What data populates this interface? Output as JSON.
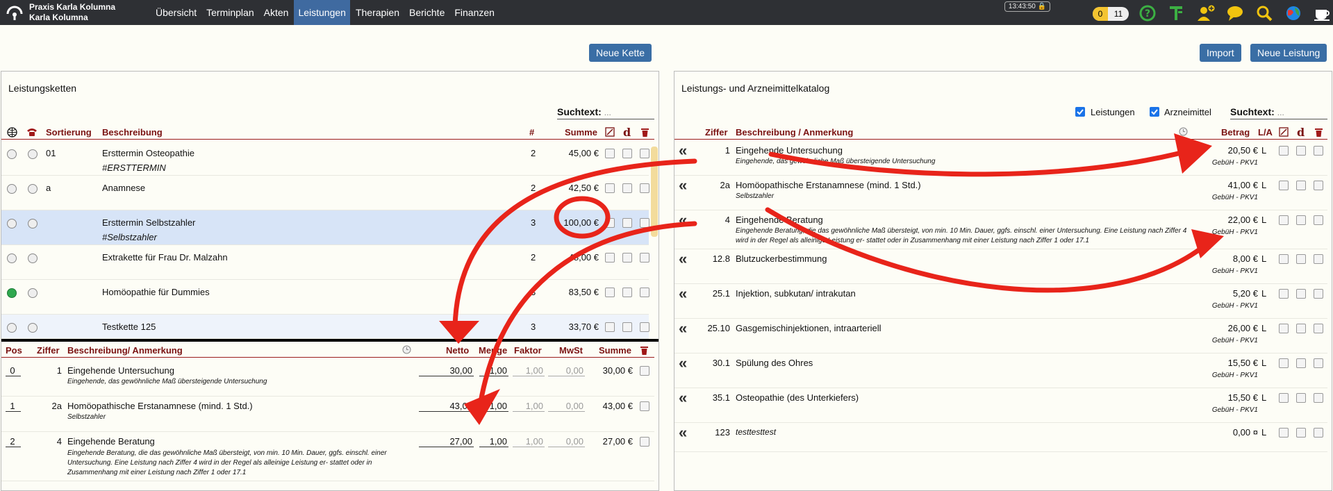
{
  "topbar": {
    "practice_name": "Praxis Karla Kolumna",
    "user_name": "Karla Kolumna",
    "nav": [
      "Übersicht",
      "Terminplan",
      "Akten",
      "Leistungen",
      "Therapien",
      "Berichte",
      "Finanzen"
    ],
    "active_nav": "Leistungen",
    "clock": "13:43:50",
    "counter_a": "0",
    "counter_b": "11",
    "icons": [
      "help-icon",
      "tools-icon",
      "add-user-icon",
      "chat-icon",
      "search-icon",
      "globe-icon",
      "coffee-icon"
    ]
  },
  "buttons": {
    "new_chain": "Neue Kette",
    "import": "Import",
    "new_service": "Neue Leistung"
  },
  "left": {
    "title": "Leistungsketten",
    "search_label": "Suchtext:",
    "search_placeholder": "...",
    "headers": {
      "sort": "Sortierung",
      "desc": "Beschreibung",
      "count": "#",
      "sum": "Summe"
    },
    "chains": [
      {
        "sort": "01",
        "desc": "Ersttermin Osteopathie",
        "tag": "#ERSTTERMIN",
        "count": "2",
        "sum": "45,00 €",
        "active": false,
        "selected": false
      },
      {
        "sort": "a",
        "desc": "Anamnese",
        "tag": "",
        "count": "2",
        "sum": "42,50 €",
        "active": false,
        "selected": false
      },
      {
        "sort": "",
        "desc": "Ersttermin Selbstzahler",
        "tag": "#Selbstzahler",
        "count": "3",
        "sum": "100,00 €",
        "active": false,
        "selected": true
      },
      {
        "sort": "",
        "desc": "Extrakette für Frau Dr. Malzahn",
        "tag": "",
        "count": "2",
        "sum": "48,00 €",
        "active": false,
        "selected": false
      },
      {
        "sort": "",
        "desc": "Homöopathie für Dummies",
        "tag": "",
        "count": "3",
        "sum": "83,50 €",
        "active": true,
        "selected": false
      },
      {
        "sort": "",
        "desc": "Testkette 125",
        "tag": "",
        "count": "3",
        "sum": "33,70 €",
        "active": false,
        "selected": false
      }
    ],
    "items_headers": {
      "pos": "Pos",
      "code": "Ziffer",
      "desc": "Beschreibung/ Anmerkung",
      "net": "Netto",
      "qty": "Menge",
      "factor": "Faktor",
      "vat": "MwSt",
      "sum": "Summe"
    },
    "items": [
      {
        "pos": "0",
        "code": "1",
        "desc": "Eingehende Untersuchung",
        "note": "Eingehende, das gewöhnliche Maß übersteigende Untersuchung",
        "net": "30,00",
        "qty": "1,00",
        "factor": "1,00",
        "vat": "0,00",
        "sum": "30,00 €"
      },
      {
        "pos": "1",
        "code": "2a",
        "desc": "Homöopathische Erstanamnese (mind. 1 Std.)",
        "note": "Selbstzahler",
        "net": "43,00",
        "qty": "1,00",
        "factor": "1,00",
        "vat": "0,00",
        "sum": "43,00 €"
      },
      {
        "pos": "2",
        "code": "4",
        "desc": "Eingehende Beratung",
        "note": "Eingehende Beratung, die das gewöhnliche Maß übersteigt, von min. 10 Min. Dauer, ggfs. einschl. einer Untersuchung. Eine Leistung nach Ziffer 4 wird in der Regel als alleinige Leistung er- stattet oder in Zusammenhang mit einer Leistung nach Ziffer 1 oder 17.1",
        "net": "27,00",
        "qty": "1,00",
        "factor": "1,00",
        "vat": "0,00",
        "sum": "27,00 €"
      }
    ]
  },
  "right": {
    "title": "Leistungs- und Arzneimittelkatalog",
    "filter_services": "Leistungen",
    "filter_drugs": "Arzneimittel",
    "search_label": "Suchtext:",
    "search_placeholder": "...",
    "headers": {
      "code": "Ziffer",
      "desc": "Beschreibung / Anmerkung",
      "amount": "Betrag",
      "la": "L/A"
    },
    "catalog": [
      {
        "code": "1",
        "desc": "Eingehende Untersuchung",
        "note": "Eingehende, das gewöhnliche Maß übersteigende Untersuchung",
        "amount": "20,50 €",
        "source": "GebüH - PKV1",
        "la": "L"
      },
      {
        "code": "2a",
        "desc": "Homöopathische Erstanamnese (mind. 1 Std.)",
        "note": "Selbstzahler",
        "amount": "41,00 €",
        "source": "GebüH - PKV1",
        "la": "L"
      },
      {
        "code": "4",
        "desc": "Eingehende Beratung",
        "note": "Eingehende Beratung, die das gewöhnliche Maß übersteigt, von min. 10 Min. Dauer, ggfs. einschl. einer Untersuchung. Eine Leistung nach Ziffer 4 wird in der Regel als alleinige Leistung er- stattet oder in Zusammenhang mit einer Leistung nach Ziffer 1 oder 17.1",
        "amount": "22,00 €",
        "source": "GebüH - PKV1",
        "la": "L"
      },
      {
        "code": "12.8",
        "desc": "Blutzuckerbestimmung",
        "note": "",
        "amount": "8,00 €",
        "source": "GebüH - PKV1",
        "la": "L"
      },
      {
        "code": "25.1",
        "desc": "Injektion, subkutan/ intrakutan",
        "note": "",
        "amount": "5,20 €",
        "source": "GebüH - PKV1",
        "la": "L"
      },
      {
        "code": "25.10",
        "desc": "Gasgemischinjektionen, intraarteriell",
        "note": "",
        "amount": "26,00 €",
        "source": "GebüH - PKV1",
        "la": "L"
      },
      {
        "code": "30.1",
        "desc": "Spülung des Ohres",
        "note": "",
        "amount": "15,50 €",
        "source": "GebüH - PKV1",
        "la": "L"
      },
      {
        "code": "35.1",
        "desc": "Osteopathie (des Unterkiefers)",
        "note": "",
        "amount": "15,50 €",
        "source": "GebüH - PKV1",
        "la": "L"
      },
      {
        "code": "123",
        "desc": "testtesttest",
        "note": "",
        "amount": "0,00 ¤",
        "source": "",
        "la": "L"
      }
    ]
  },
  "colors": {
    "accent": "#3a6ea5",
    "header_text": "#7a1212",
    "selected_row": "#d7e4f7",
    "annotation": "#e8241a",
    "active_dot": "#2fa84f"
  }
}
